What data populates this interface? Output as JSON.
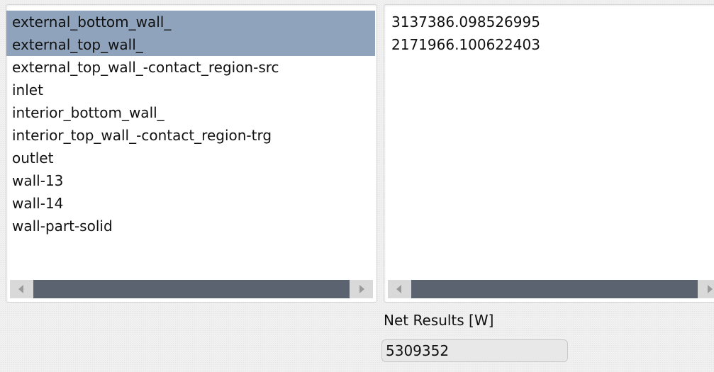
{
  "zones": {
    "items": [
      {
        "label": "external_bottom_wall_",
        "selected": true
      },
      {
        "label": "external_top_wall_",
        "selected": true
      },
      {
        "label": "external_top_wall_-contact_region-src",
        "selected": false
      },
      {
        "label": "inlet",
        "selected": false
      },
      {
        "label": "interior_bottom_wall_",
        "selected": false
      },
      {
        "label": "interior_top_wall_-contact_region-trg",
        "selected": false
      },
      {
        "label": "outlet",
        "selected": false
      },
      {
        "label": "wall-13",
        "selected": false
      },
      {
        "label": "wall-14",
        "selected": false
      },
      {
        "label": "wall-part-solid",
        "selected": false
      }
    ]
  },
  "results": {
    "values": [
      "3137386.098526995",
      "2171966.100622403"
    ]
  },
  "net": {
    "label": "Net Results [W]",
    "value": "5309352"
  },
  "colors": {
    "selection": "#8fa4bc",
    "scroll_thumb": "#5c6370"
  }
}
